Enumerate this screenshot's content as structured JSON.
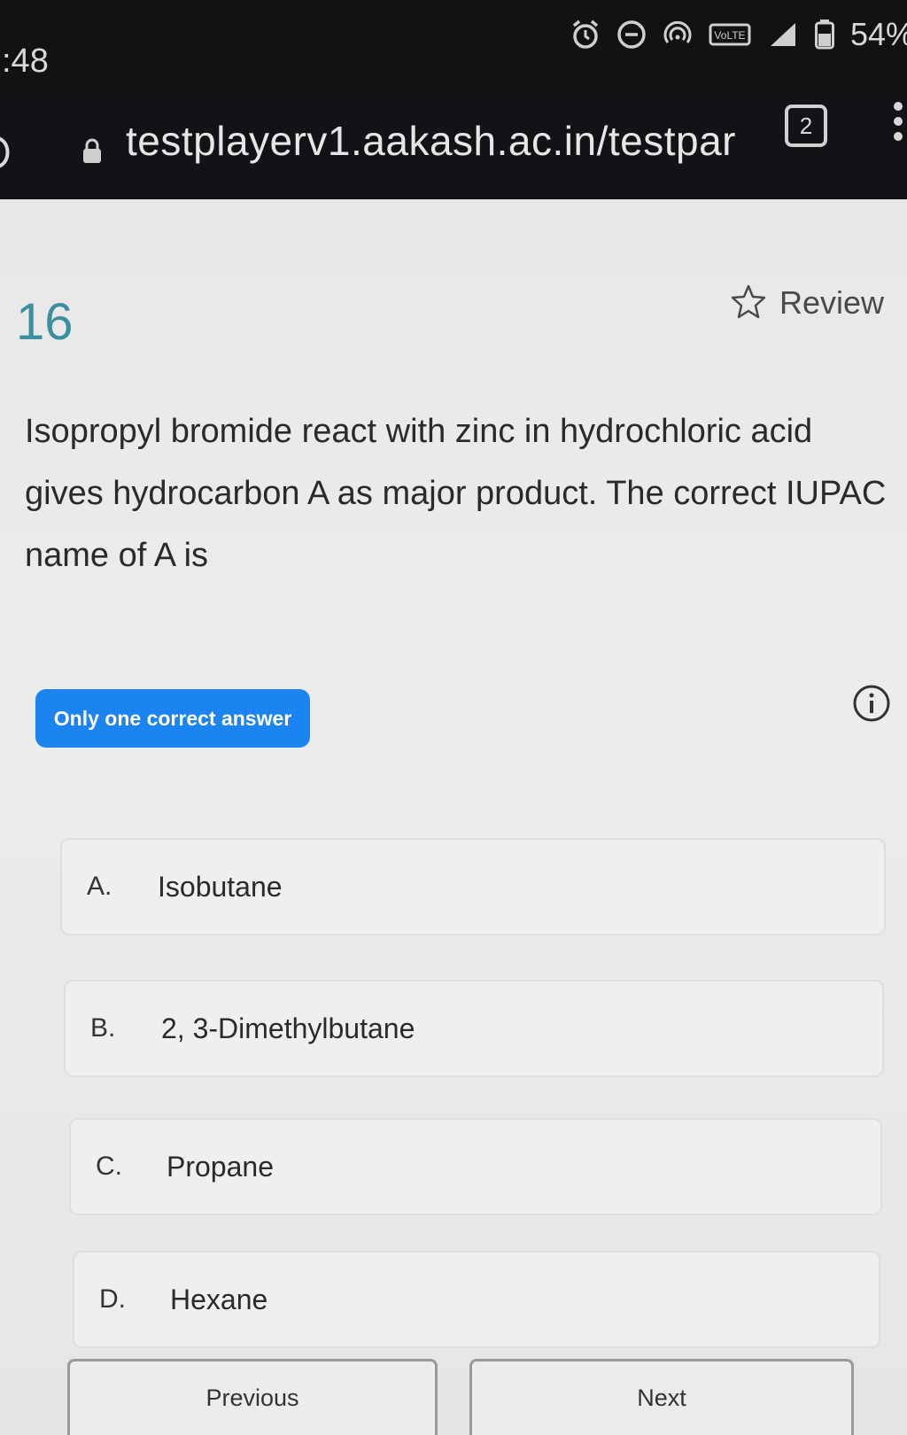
{
  "status_bar": {
    "time": ":48",
    "battery": "54%",
    "icons": [
      "alarm-icon",
      "dnd-icon",
      "hotspot-icon",
      "volte-icon",
      "signal-icon",
      "battery-icon"
    ]
  },
  "browser": {
    "url": "testplayerv1.aakash.ac.in/testpar",
    "tab_count": "2"
  },
  "question": {
    "number": "16",
    "review_label": "Review",
    "text": "Isopropyl bromide react with zinc in hydrochloric acid gives hydrocarbon A as major product. The correct IUPAC name of A is",
    "answer_type": "Only one correct answer"
  },
  "options": [
    {
      "letter": "A.",
      "label": "Isobutane"
    },
    {
      "letter": "B.",
      "label": "2, 3-Dimethylbutane"
    },
    {
      "letter": "C.",
      "label": "Propane"
    },
    {
      "letter": "D.",
      "label": "Hexane"
    }
  ],
  "navigation": {
    "previous_label": "Previous",
    "next_label": "Next"
  },
  "colors": {
    "accent": "#1b84f0",
    "question_number": "#3a8fa0"
  }
}
